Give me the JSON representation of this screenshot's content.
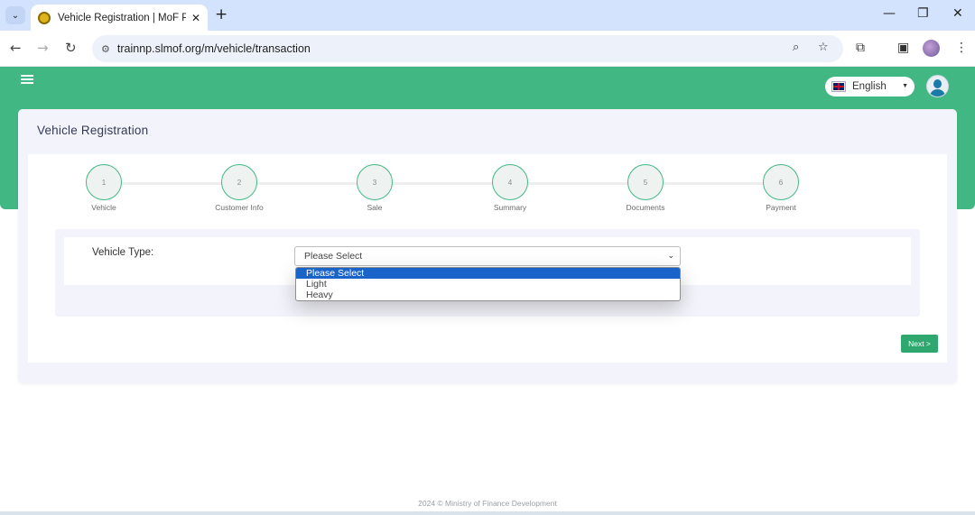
{
  "browser": {
    "tab_title": "Vehicle Registration | MoF Portal",
    "url": "trainnp.slmof.org/m/vehicle/transaction",
    "new_tab": "+",
    "close": "✕",
    "minimize": "—",
    "restore": "❐",
    "window_close": "✕"
  },
  "header": {
    "language": "English"
  },
  "page": {
    "title": "Vehicle Registration"
  },
  "steps": [
    {
      "number": "1",
      "label": "Vehicle"
    },
    {
      "number": "2",
      "label": "Customer Info"
    },
    {
      "number": "3",
      "label": "Sale"
    },
    {
      "number": "4",
      "label": "Summary"
    },
    {
      "number": "5",
      "label": "Documents"
    },
    {
      "number": "6",
      "label": "Payment"
    }
  ],
  "form": {
    "vehicle_type_label": "Vehicle Type:",
    "vehicle_type_value": "Please Select",
    "options": [
      "Please Select",
      "Light",
      "Heavy"
    ]
  },
  "actions": {
    "next_label": "Next >"
  },
  "footer": {
    "text": "2024 © Ministry of Finance Development"
  },
  "colors": {
    "brand": "#41b883",
    "selected_option": "#1a63c9"
  }
}
